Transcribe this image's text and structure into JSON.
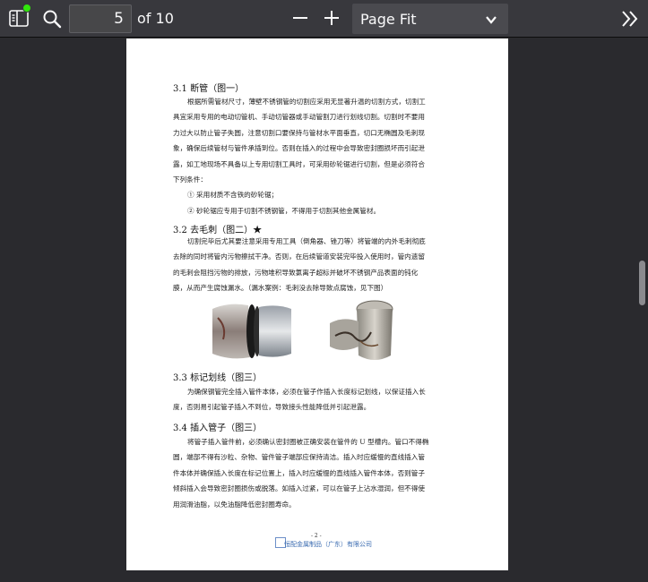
{
  "toolbar": {
    "page_number": "5",
    "page_of": "of 10",
    "zoom_value": "Page Fit",
    "icons": [
      "sidebar-toggle-icon",
      "search-icon",
      "zoom-out-icon",
      "zoom-in-icon",
      "chevron-down-icon",
      "double-chevron-right-icon"
    ],
    "colors": {
      "toolbar": "#38383d",
      "viewer": "#2a2a2e",
      "notification_dot": "#30e60b"
    }
  },
  "document": {
    "s31_title": "3.1 断管（图一）",
    "s31_lines": [
      "根据所需管材尺寸，薄壁不锈钢管的切割应采用无显著升温的切割方式，切割工",
      "具宜采用专用的电动切管机、手动切管器或手动管割刀进行划线切割。切割时不要用",
      "力过大以防止管子失圆，注意切割口要保持与管材水平面垂直，切口无椭圆及毛刺现",
      "象，确保后续管材与管件承插到位。否则在插入的过程中会导致密封圈损坏而引起泄",
      "露，如工地现场不具备以上专用切割工具时，可采用砂轮锯进行切割，但是必须符合",
      "下列条件："
    ],
    "s31_items": [
      "① 采用材质不含铁的砂轮锯；",
      "② 砂轮锯应专用于切割不锈钢管，不得用于切割其他金属管材。"
    ],
    "s32_title": "3.2 去毛刺（图二）★",
    "s32_lines": [
      "切割完毕后尤其要注意采用专用工具（倒角器、锉刀等）将管端的内外毛刺彻底",
      "去除的同时将管内污物擦拭干净。否则，在后续管道安装完毕投入使用时，管内遗留",
      "的毛刺会阻挡污物的排放，污物堆积导致氯离子超标并破坏不锈钢产品表面的钝化",
      "膜，从而产生腐蚀漏水。（漏水案例：毛刺没去除导致点腐蚀，见下图）"
    ],
    "s33_title": "3.3 标记划线（图三）",
    "s33_lines": [
      "为确保钢管完全插入管件本体，必须在管子作插入长度标记划线，以保证插入长",
      "度，否则易引起管子插入不到位，导致接头性能降低并引起泄露。"
    ],
    "s34_title": "3.4 插入管子（图三）",
    "s34_lines": [
      "将管子插入管件前，必须确认密封圈被正确安装在管件的 U 型槽内。管口不得椭",
      "圆，端部不得有沙粒、杂物、管件管子端部应保持清洁。插入时应缓慢的直线插入管",
      "件本体并确保插入长度在标记位置上，插入时应缓慢的直线插入管件本体，否则管子",
      "倾斜插入会导致密封圈损伤或脱落。如插入过紧，可以在管子上沾水湿润，但不得使",
      "用润滑油脂，以免油脂降低密封圈寿命。"
    ],
    "page_footer": "- 2 -",
    "company": "恒配金属制品（广东）有限公司"
  }
}
